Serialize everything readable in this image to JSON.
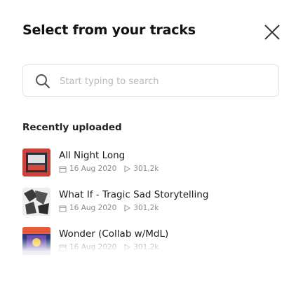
{
  "header": {
    "title": "Select from your tracks",
    "close_icon": "close-icon"
  },
  "search": {
    "placeholder": "Start typing to search",
    "value": "",
    "icon": "search-icon"
  },
  "section": {
    "title": "Recently uploaded"
  },
  "tracks": [
    {
      "name": "All Night Long",
      "date": "16 Aug 2020",
      "plays": "301,2k",
      "thumb_color": "#c9433a"
    },
    {
      "name": "What If - Tragic Sad Storytelling",
      "date": "16 Aug 2020",
      "plays": "301,2k",
      "thumb_color": "#3a3a3a"
    },
    {
      "name": "Wonder (Collab w/MdL)",
      "date": "16 Aug 2020",
      "plays": "301,2k",
      "thumb_color": "#2d3a7a"
    }
  ]
}
